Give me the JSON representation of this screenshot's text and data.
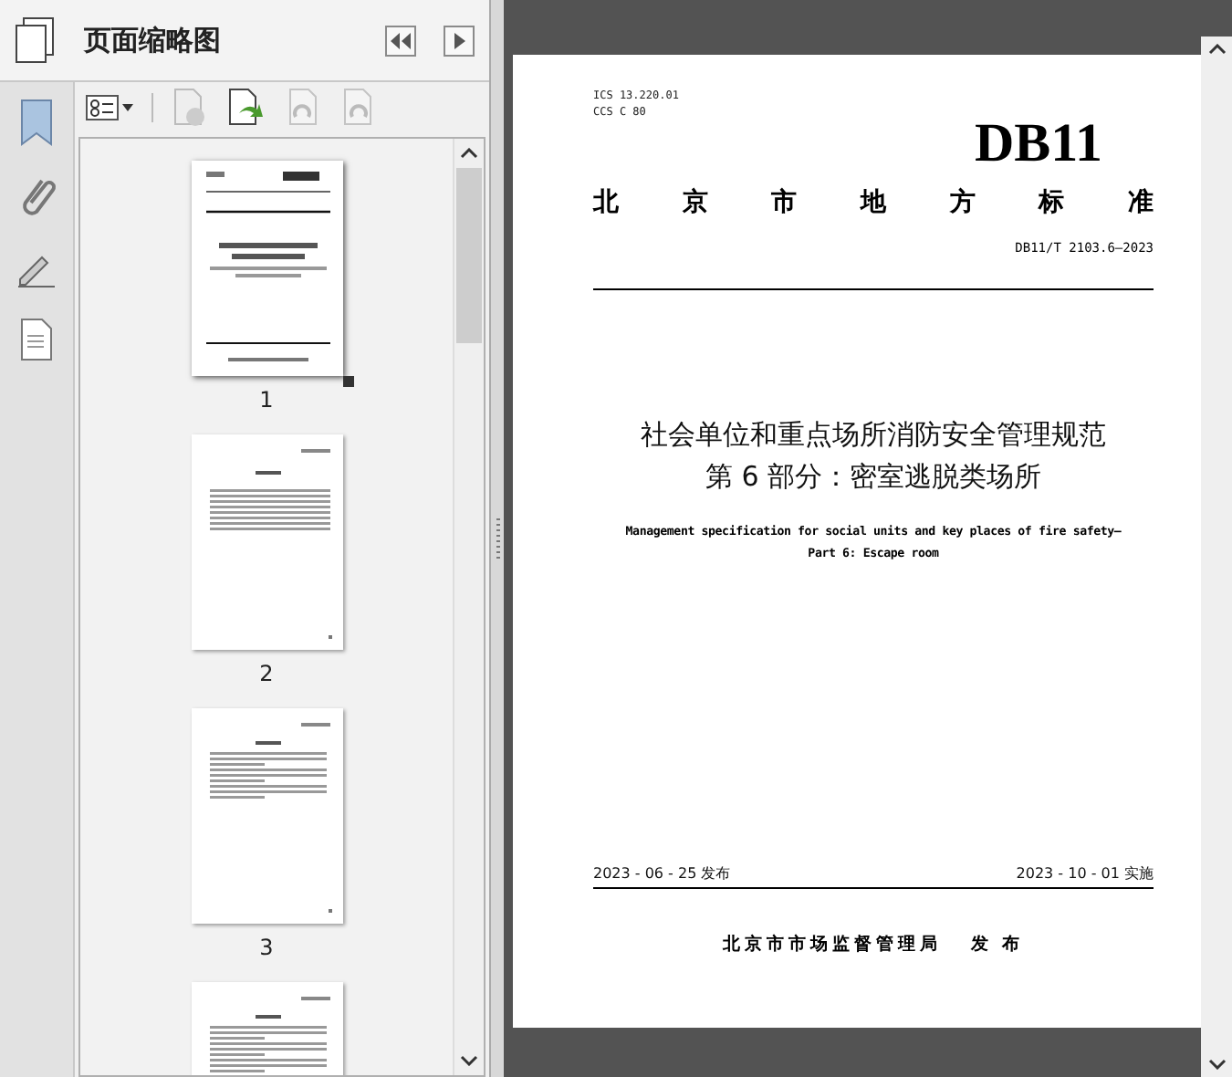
{
  "panel": {
    "title": "页面缩略图"
  },
  "thumbnails": [
    {
      "kind": "cover",
      "label": "1",
      "selected": true
    },
    {
      "kind": "toc",
      "label": "2",
      "selected": false
    },
    {
      "kind": "text",
      "label": "3",
      "selected": false
    },
    {
      "kind": "text",
      "selected": false
    }
  ],
  "page": {
    "ics": [
      "ICS  13.220.01",
      "CCS  C 80"
    ],
    "code": "DB11",
    "standard_type": "北京市地方标准",
    "number": "DB11/T 2103.6—2023",
    "title_lines": [
      "社会单位和重点场所消防安全管理规范",
      "第 6 部分：密室逃脱类场所"
    ],
    "english_lines": [
      "Management specification for social units and key places of fire safety—",
      "Part 6: Escape room"
    ],
    "issue_date": "2023 - 06 - 25 发布",
    "effective_date": "2023 - 10 - 01 实施",
    "issuer": "北京市市场监督管理局",
    "issue_word": "发 布"
  }
}
